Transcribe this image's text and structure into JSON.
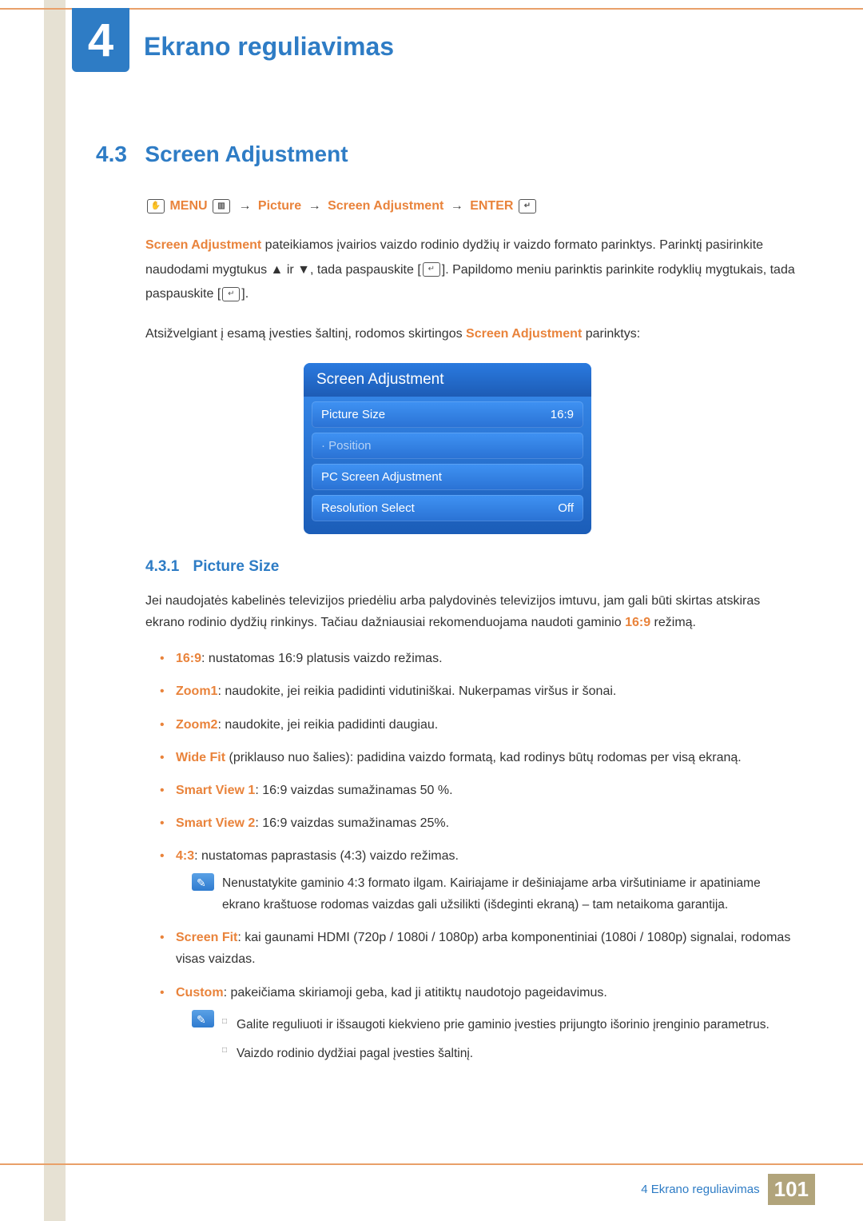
{
  "chapter": {
    "number": "4",
    "title": "Ekrano reguliavimas"
  },
  "section": {
    "number": "4.3",
    "title": "Screen Adjustment"
  },
  "nav_path": {
    "menu": "MENU",
    "step1": "Picture",
    "step2": "Screen Adjustment",
    "enter": "ENTER",
    "arrow": "→"
  },
  "intro": {
    "strong1": "Screen Adjustment",
    "text1": " pateikiamos įvairios vaizdo rodinio dydžių ir vaizdo formato parinktys. Parinktį pasirinkite naudodami mygtukus ",
    "tri_up": "▲",
    "ir": " ir ",
    "tri_down": "▼",
    "text2": ", tada paspauskite [",
    "text3": "]. Papildomo meniu parinktis parinkite rodyklių mygtukais, tada paspauskite [",
    "text4": "]."
  },
  "depends": {
    "before": "Atsižvelgiant į esamą įvesties šaltinį, rodomos skirtingos ",
    "strong": "Screen Adjustment",
    "after": " parinktys:"
  },
  "osd": {
    "title": "Screen Adjustment",
    "rows": [
      {
        "label": "Picture Size",
        "value": "16:9"
      },
      {
        "label": "· Position",
        "value": ""
      },
      {
        "label": "PC Screen Adjustment",
        "value": ""
      },
      {
        "label": "Resolution Select",
        "value": "Off"
      }
    ]
  },
  "subsection": {
    "number": "4.3.1",
    "title": "Picture Size"
  },
  "picture_size_para": {
    "text1": "Jei naudojatės kabelinės televizijos priedėliu arba palydovinės televizijos imtuvu, jam gali būti skirtas atskiras ekrano rodinio dydžių rinkinys. Tačiau dažniausiai rekomenduojama naudoti gaminio ",
    "kw": "16:9",
    "text2": " režimą."
  },
  "modes": [
    {
      "kw": "16:9",
      "desc": ": nustatomas 16:9 platusis vaizdo režimas."
    },
    {
      "kw": "Zoom1",
      "desc": ": naudokite, jei reikia padidinti vidutiniškai. Nukerpamas viršus ir šonai."
    },
    {
      "kw": "Zoom2",
      "desc": ": naudokite, jei reikia padidinti daugiau."
    },
    {
      "kw": "Wide Fit",
      "desc": " (priklauso nuo šalies): padidina vaizdo formatą, kad rodinys būtų rodomas per visą ekraną."
    },
    {
      "kw": "Smart View 1",
      "desc": ": 16:9 vaizdas sumažinamas 50 %."
    },
    {
      "kw": "Smart View 2",
      "desc": ": 16:9 vaizdas sumažinamas 25%."
    },
    {
      "kw": "4:3",
      "desc": ": nustatomas paprastasis (4:3) vaizdo režimas."
    }
  ],
  "note43": "Nenustatykite gaminio 4:3 formato ilgam. Kairiajame ir dešiniajame arba viršutiniame ir apatiniame ekrano kraštuose rodomas vaizdas gali užsilikti (išdeginti ekraną) – tam netaikoma garantija.",
  "modes2": [
    {
      "kw": "Screen Fit",
      "desc": ": kai gaunami HDMI (720p / 1080i / 1080p) arba komponentiniai (1080i / 1080p) signalai, rodomas visas vaizdas."
    },
    {
      "kw": "Custom",
      "desc": ": pakeičiama skiriamoji geba, kad ji atitiktų naudotojo pageidavimus."
    }
  ],
  "custom_notes": [
    "Galite reguliuoti ir išsaugoti kiekvieno prie gaminio įvesties prijungto išorinio įrenginio parametrus.",
    "Vaizdo rodinio dydžiai pagal įvesties šaltinį."
  ],
  "footer": {
    "text": "4 Ekrano reguliavimas",
    "page": "101"
  }
}
